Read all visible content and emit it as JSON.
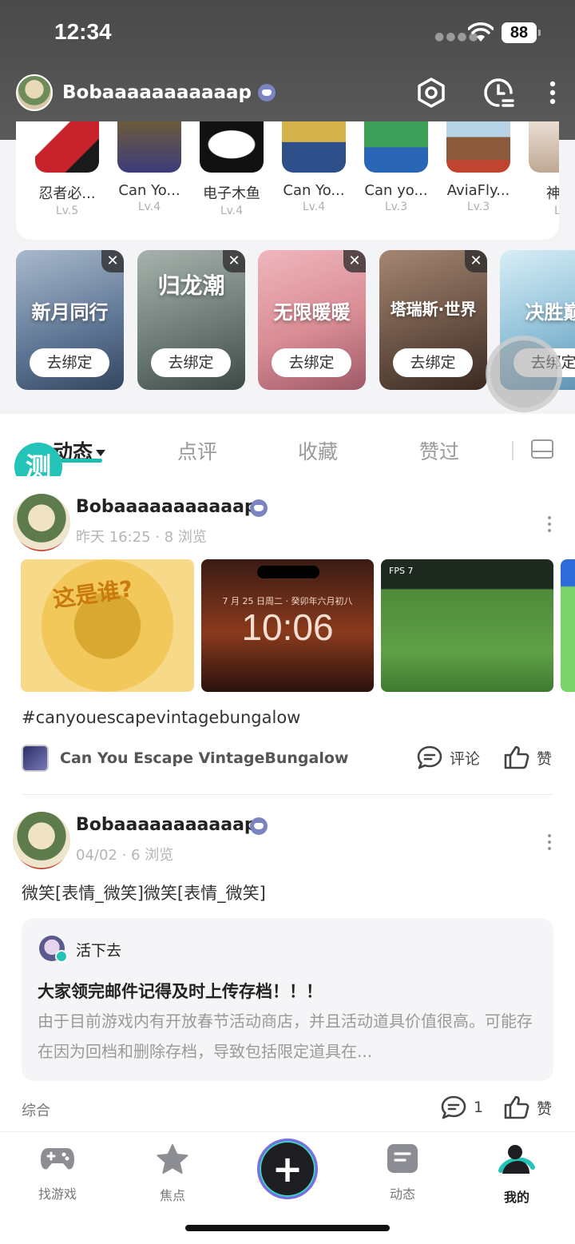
{
  "status_bar": {
    "time": "12:34",
    "battery": "88"
  },
  "header": {
    "username": "Bobaaaaaaaaaaap"
  },
  "played_games": [
    {
      "name": "忍者必...",
      "level": "Lv.5",
      "color": "#c8232c"
    },
    {
      "name": "Can Yo...",
      "level": "Lv.4",
      "color": "#3b3d7a"
    },
    {
      "name": "电子木鱼",
      "level": "Lv.4",
      "color": "#111111"
    },
    {
      "name": "Can Yo...",
      "level": "Lv.4",
      "color": "#2f4f8a"
    },
    {
      "name": "Can yo...",
      "level": "Lv.3",
      "color": "#2a66b5"
    },
    {
      "name": "AviaFly...",
      "level": "Lv.3",
      "color": "#c0442f"
    },
    {
      "name": "神行",
      "level": "Lv",
      "color": "#d9c7b8"
    }
  ],
  "bound_games": [
    {
      "title": "新月同行",
      "unbind_label": "去绑定",
      "color": "#6c86a6"
    },
    {
      "title": "归龙潮",
      "unbind_label": "去绑定",
      "color": "#6f7d77"
    },
    {
      "title": "无限暖暖",
      "unbind_label": "去绑定",
      "color": "#d98c94"
    },
    {
      "title": "塔瑞斯·世界",
      "unbind_label": "去绑定",
      "color": "#6b5446"
    },
    {
      "title": "决胜巅",
      "unbind_label": "去绑定",
      "color": "#8fc0d8"
    }
  ],
  "tabs": {
    "active": "动态",
    "review": "点评",
    "favorites": "收藏",
    "liked": "赞过"
  },
  "badge": "测",
  "posts": [
    {
      "author": "Bobaaaaaaaaaaap",
      "meta": "昨天 16:25 · 8 浏览",
      "images": {
        "lock_date": "7 月 25 日周二 · 癸卯年六月初八",
        "lock_time": "10:06",
        "comic_text": "这是谁?",
        "fps": "FPS 7"
      },
      "hashtag": "#canyouescapevintagebungalow",
      "game": "Can You Escape VintageBungalow",
      "comment_label": "评论",
      "like_label": "赞"
    },
    {
      "author": "Bobaaaaaaaaaaap",
      "meta": "04/02 · 6 浏览",
      "text": "微笑[表情_微笑]微笑[表情_微笑]",
      "quote": {
        "author": "活下去",
        "title": "大家领完邮件记得及时上传存档！！！",
        "body": "由于目前游戏内有开放春节活动商店，并且活动道具价值很高。可能存在因为回档和删除存档，导致包括限定道具在..."
      },
      "category": "综合",
      "comment_count": "1",
      "like_label": "赞"
    }
  ],
  "bottom_nav": [
    {
      "label": "找游戏"
    },
    {
      "label": "焦点"
    },
    {
      "label": "动态"
    },
    {
      "label": "我的"
    }
  ],
  "accent_color": "#23c3b8"
}
